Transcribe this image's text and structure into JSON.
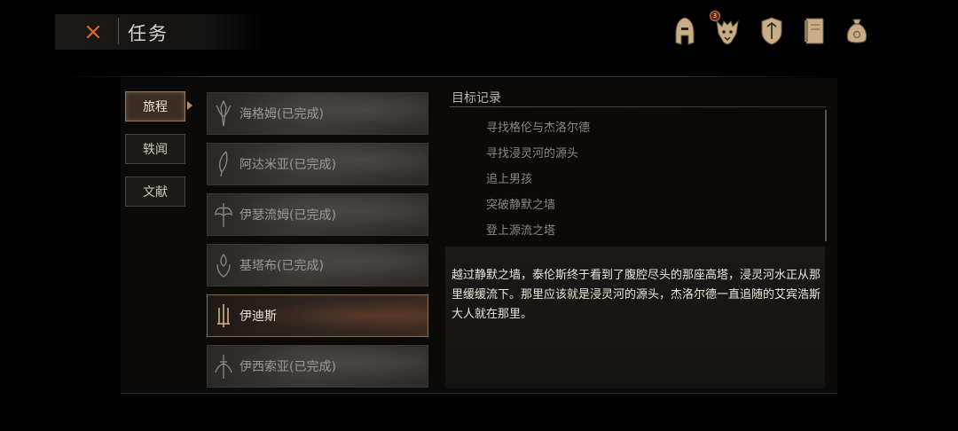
{
  "header": {
    "title": "任务"
  },
  "top_icons": [
    "helmet-icon",
    "beast-mask-icon",
    "shield-icon",
    "journal-icon",
    "coin-bag-icon"
  ],
  "badge": {
    "count": "3"
  },
  "categories": [
    {
      "label": "旅程",
      "active": true
    },
    {
      "label": "轶闻",
      "active": false
    },
    {
      "label": "文献",
      "active": false
    }
  ],
  "quests": [
    {
      "label": "海格姆(已完成)",
      "icon": "spear-crest-icon",
      "active": false
    },
    {
      "label": "阿达米亚(已完成)",
      "icon": "feather-icon",
      "active": false
    },
    {
      "label": "伊瑟流姆(已完成)",
      "icon": "winged-axe-icon",
      "active": false
    },
    {
      "label": "基塔布(已完成)",
      "icon": "flame-crest-icon",
      "active": false
    },
    {
      "label": "伊迪斯",
      "icon": "triple-blade-icon",
      "active": true
    },
    {
      "label": "伊西索亚(已完成)",
      "icon": "winged-sword-icon",
      "active": false
    }
  ],
  "objectives": {
    "title": "目标记录",
    "items": [
      "寻找格伦与杰洛尔德",
      "寻找浸灵河的源头",
      "追上男孩",
      "突破静默之墙",
      "登上源流之塔"
    ]
  },
  "description": "越过静默之墙，泰伦斯终于看到了腹腔尽头的那座高塔，浸灵河水正从那里缓缓流下。那里应该就是浸灵河的源头，杰洛尔德一直追随的艾宾浩斯大人就在那里。",
  "colors": {
    "accent": "#9a7b55",
    "close": "#e0672a",
    "icon_gold": "#c9ad86"
  }
}
